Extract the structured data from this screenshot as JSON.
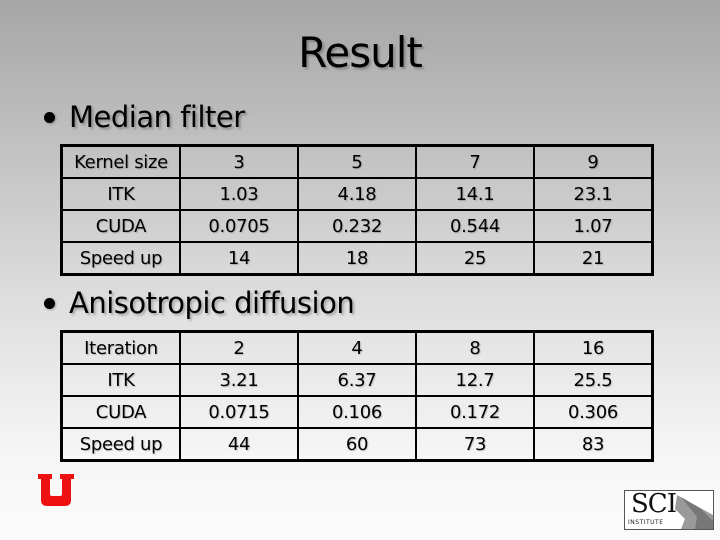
{
  "slide": {
    "title": "Result",
    "sections": [
      {
        "heading": "Median filter",
        "table": {
          "rows": [
            [
              "Kernel size",
              "3",
              "5",
              "7",
              "9"
            ],
            [
              "ITK",
              "1.03",
              "4.18",
              "14.1",
              "23.1"
            ],
            [
              "CUDA",
              "0.0705",
              "0.232",
              "0.544",
              "1.07"
            ],
            [
              "Speed up",
              "14",
              "18",
              "25",
              "21"
            ]
          ]
        }
      },
      {
        "heading": "Anisotropic diffusion",
        "table": {
          "rows": [
            [
              "Iteration",
              "2",
              "4",
              "8",
              "16"
            ],
            [
              "ITK",
              "3.21",
              "6.37",
              "12.7",
              "25.5"
            ],
            [
              "CUDA",
              "0.0715",
              "0.106",
              "0.172",
              "0.306"
            ],
            [
              "Speed up",
              "44",
              "60",
              "73",
              "83"
            ]
          ]
        }
      }
    ],
    "logos": {
      "left": {
        "icon": "university-of-utah-u-logo",
        "color": "#ee1111"
      },
      "right": {
        "icon": "sci-institute-logo",
        "main_text": "SCI",
        "sub_text": "INSTITUTE"
      }
    }
  }
}
